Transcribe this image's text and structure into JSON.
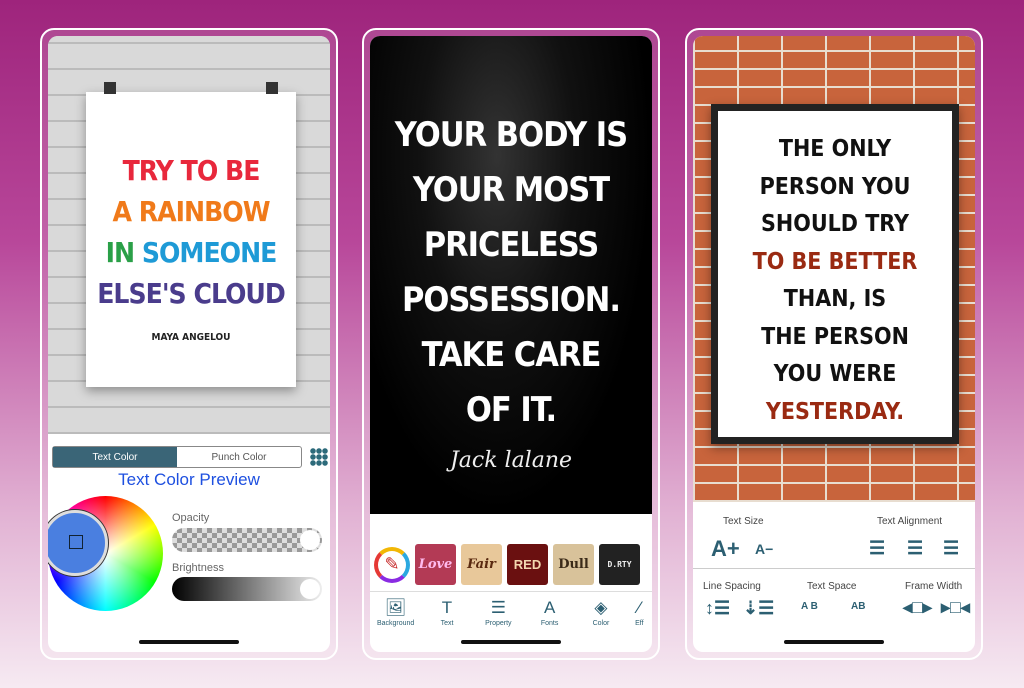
{
  "phone1": {
    "poster": {
      "lines": [
        {
          "text": "TRY TO BE",
          "color": "#e8283c"
        },
        {
          "text": "A RAINBOW",
          "color": "#f07a1a"
        },
        {
          "parts": [
            {
              "text": "IN ",
              "color": "#2aa048"
            },
            {
              "text": "SOMEONE",
              "color": "#1e9ad6"
            }
          ]
        },
        {
          "text": "ELSE'S CLOUD",
          "color": "#4a3c8c"
        }
      ],
      "author": "MAYA ANGELOU"
    },
    "tabs": [
      "Text Color",
      "Punch Color"
    ],
    "preview_title": "Text Color Preview",
    "opacity_label": "Opacity",
    "brightness_label": "Brightness",
    "opacity_value": 1.0,
    "brightness_value": 1.0
  },
  "phone2": {
    "quote": [
      "YOUR BODY IS",
      "YOUR MOST",
      "PRICELESS",
      "POSSESSION.",
      "TAKE CARE",
      "OF IT."
    ],
    "signature": "Jack lalane",
    "font_styles": [
      "Love",
      "Fair",
      "RED",
      "Dull",
      "D.RTY"
    ],
    "toolbar": [
      "Background",
      "Text",
      "Property",
      "Fonts",
      "Color",
      "Eff"
    ]
  },
  "phone3": {
    "quote": [
      {
        "text": "THE ONLY",
        "accent": false
      },
      {
        "text": "PERSON YOU",
        "accent": false
      },
      {
        "text": "SHOULD TRY",
        "accent": false
      },
      {
        "text": "TO BE BETTER",
        "accent": true
      },
      {
        "text": "THAN, IS",
        "accent": false
      },
      {
        "text": "THE PERSON",
        "accent": false
      },
      {
        "text": "YOU WERE",
        "accent": false
      },
      {
        "text": "YESTERDAY.",
        "accent": true
      }
    ],
    "labels": {
      "text_size": "Text Size",
      "text_alignment": "Text Alignment",
      "line_spacing": "Line Spacing",
      "text_space": "Text Space",
      "frame_width": "Frame Width"
    },
    "icon_glyphs": {
      "increase": "A+",
      "decrease": "A−",
      "space_wide": "A B",
      "space_narrow": "AB"
    }
  },
  "colors": {
    "accent": "#2c5f72",
    "background": "#9e247c",
    "preview": "#1e50e0"
  }
}
